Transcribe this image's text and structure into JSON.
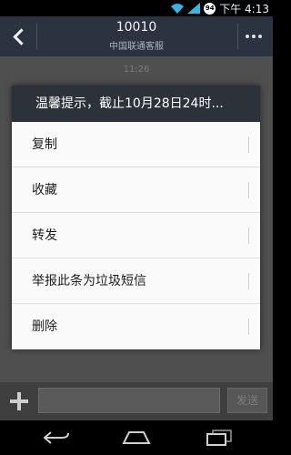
{
  "status": {
    "time": "下午 4:13",
    "battery": "94"
  },
  "header": {
    "title": "10010",
    "subtitle": "中国联通客服"
  },
  "chat": {
    "timestamp": "11:26"
  },
  "dialog": {
    "title": "温馨提示，截止10月28日24时...",
    "items": [
      {
        "label": "复制"
      },
      {
        "label": "收藏"
      },
      {
        "label": "转发"
      },
      {
        "label": "举报此条为垃圾短信"
      },
      {
        "label": "删除"
      }
    ]
  },
  "input": {
    "send_label": "发送"
  },
  "colors": {
    "status_accent": "#33b5e5",
    "header_bg": "#2b3340",
    "dialog_title_bg": "#2c323a"
  }
}
